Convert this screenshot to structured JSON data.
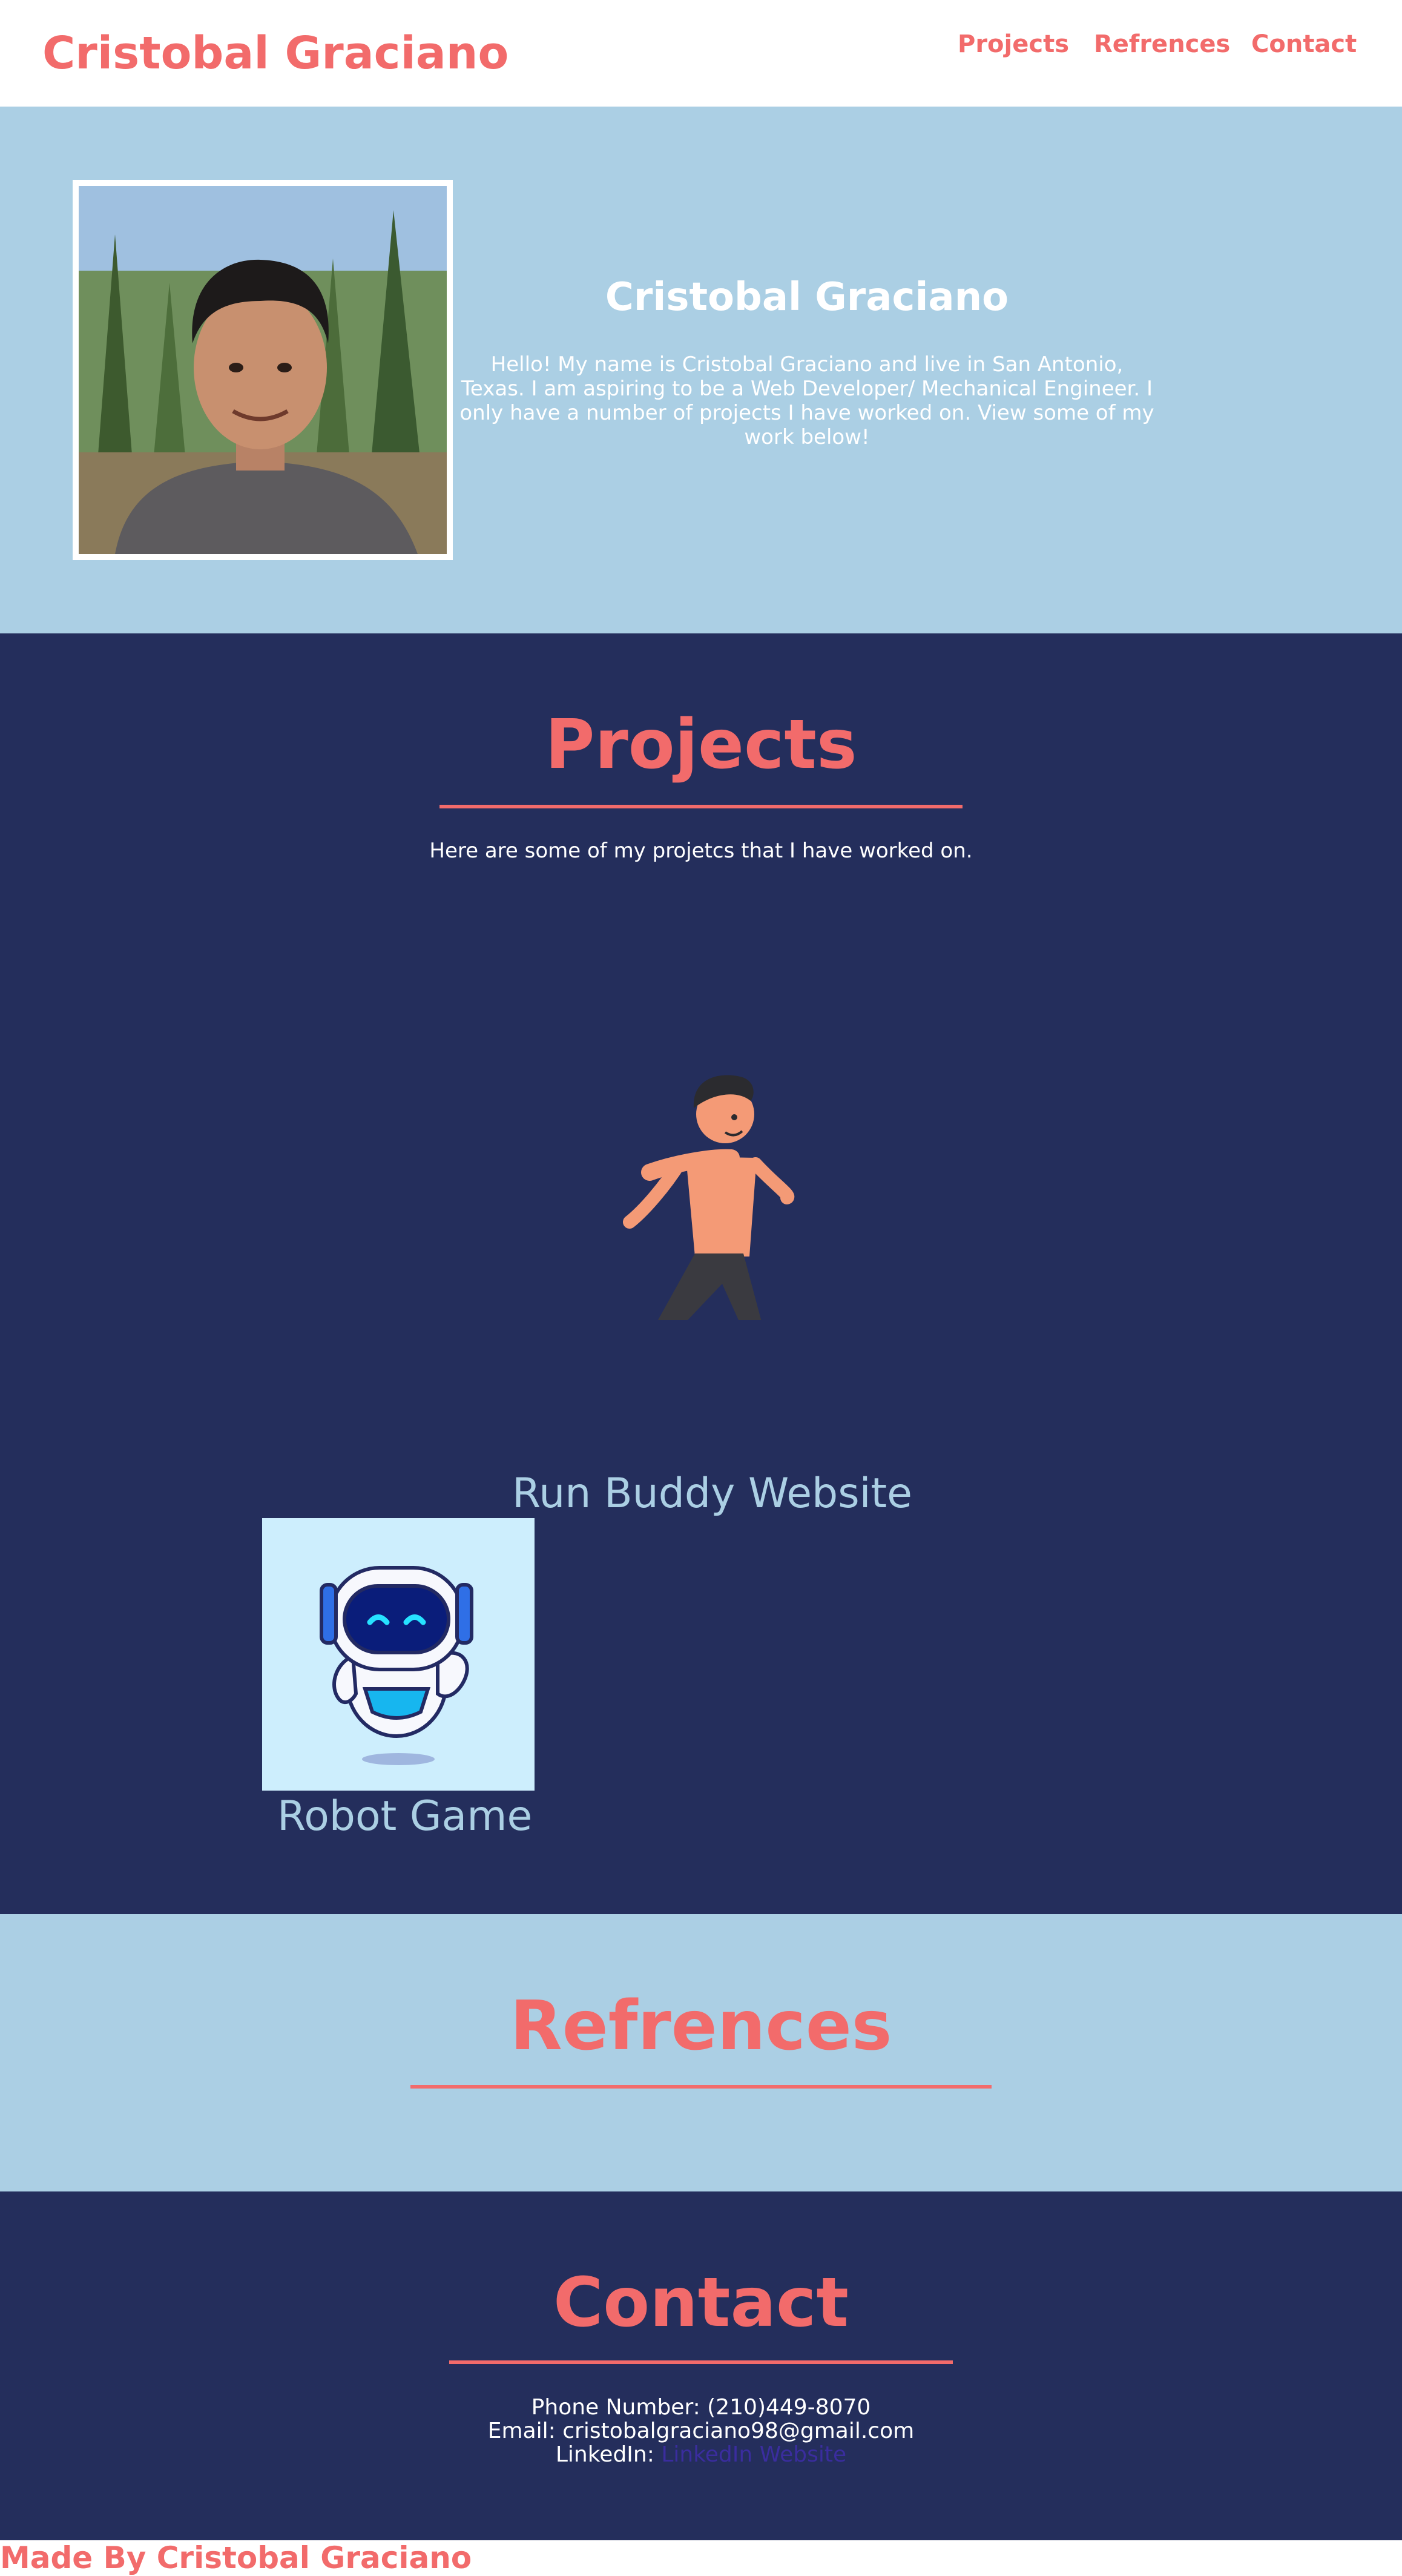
{
  "header": {
    "brand": "Cristobal Graciano",
    "nav": [
      "Projects",
      "Refrences",
      "Contact"
    ]
  },
  "hero": {
    "name": "Cristobal Graciano",
    "bio": "Hello! My name is Cristobal Graciano and live in San Antonio, Texas. I am aspiring to be a Web Developer/ Mechanical Engineer. I only have a number of projects I have worked on. View some of my work below!",
    "photo_icon": "profile-photo"
  },
  "projects": {
    "title": "Projects",
    "subtitle": "Here are some of my projetcs that I have worked on.",
    "items": [
      {
        "caption": "Run Buddy Website",
        "icon": "running-man-illustration"
      },
      {
        "caption": "Robot Game",
        "icon": "robot-illustration"
      }
    ]
  },
  "references": {
    "title": "Refrences"
  },
  "contact": {
    "title": "Contact",
    "phone": "Phone Number: (210)449-8070",
    "email": "Email: cristobalgraciano98@gmail.com",
    "linkedin_label": "LinkedIn: ",
    "linkedin_link": "LinkedIn Website"
  },
  "footer": {
    "text": "Made By Cristobal Graciano"
  },
  "colors": {
    "accent": "#f26b6b",
    "light_blue": "#abcfe4",
    "navy": "#242e5c",
    "robot_bg": "#cdeefd"
  }
}
